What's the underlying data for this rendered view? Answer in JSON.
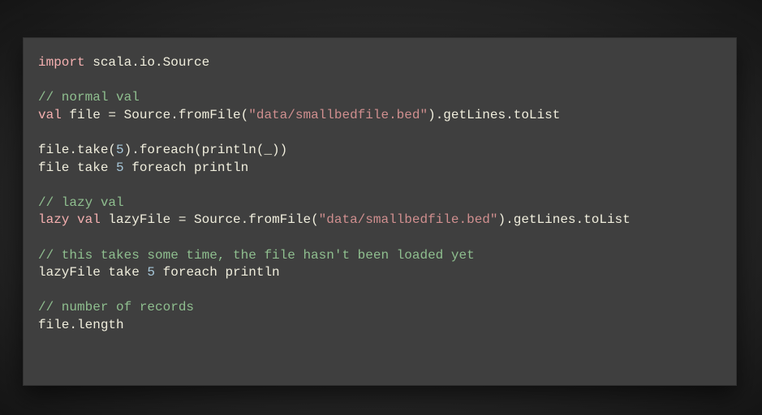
{
  "code": {
    "l01_kw": "import",
    "l01_rest": " scala.io.Source",
    "l03_cm": "// normal val",
    "l04_kw": "val",
    "l04_a": " file = Source.fromFile(",
    "l04_str": "\"data/smallbedfile.bed\"",
    "l04_b": ").getLines.toList",
    "l06_a": "file.take(",
    "l06_num": "5",
    "l06_b": ").foreach(println(_))",
    "l07_a": "file take ",
    "l07_num": "5",
    "l07_b": " foreach println",
    "l09_cm": "// lazy val",
    "l10_kw1": "lazy",
    "l10_sp": " ",
    "l10_kw2": "val",
    "l10_a": " lazyFile = Source.fromFile(",
    "l10_str": "\"data/smallbedfile.bed\"",
    "l10_b": ").getLines.toList",
    "l12_cm": "// this takes some time, the file hasn't been loaded yet",
    "l13_a": "lazyFile take ",
    "l13_num": "5",
    "l13_b": " foreach println",
    "l15_cm": "// number of records",
    "l16": "file.length"
  }
}
